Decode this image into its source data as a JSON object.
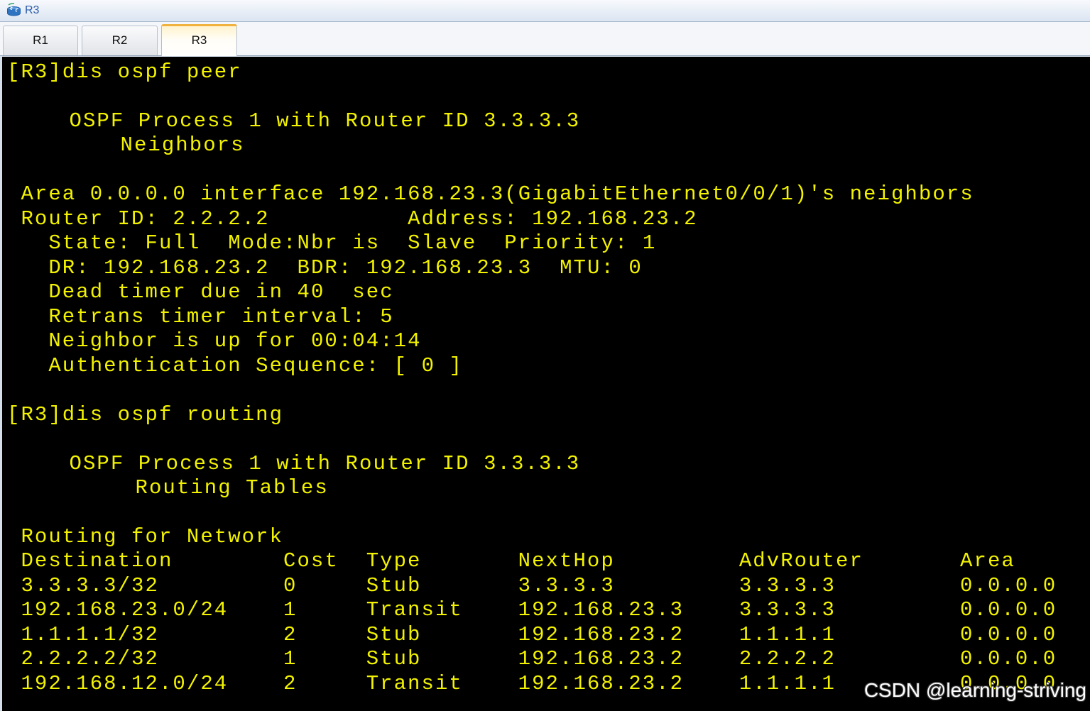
{
  "window": {
    "title": "R3",
    "icon": "router-icon"
  },
  "tabs": [
    {
      "label": "R1",
      "active": false
    },
    {
      "label": "R2",
      "active": false
    },
    {
      "label": "R3",
      "active": true
    }
  ],
  "terminal": {
    "peer": {
      "command": "[R3]dis ospf peer",
      "process_line": "OSPF Process 1 with Router ID 3.3.3.3",
      "title": "Neighbors",
      "area_line": "Area 0.0.0.0 interface 192.168.23.3(GigabitEthernet0/0/1)'s neighbors",
      "router_line": "Router ID: 2.2.2.2          Address: 192.168.23.2",
      "details": [
        "State: Full  Mode:Nbr is  Slave  Priority: 1",
        "DR: 192.168.23.2  BDR: 192.168.23.3  MTU: 0",
        "Dead timer due in 40  sec",
        "Retrans timer interval: 5",
        "Neighbor is up for 00:04:14",
        "Authentication Sequence: [ 0 ]"
      ]
    },
    "routing": {
      "command": "[R3]dis ospf routing",
      "process_line": "OSPF Process 1 with Router ID 3.3.3.3",
      "title": "Routing Tables",
      "section": "Routing for Network",
      "columns": [
        "Destination",
        "Cost",
        "Type",
        "NextHop",
        "AdvRouter",
        "Area"
      ],
      "rows": [
        [
          "3.3.3.3/32",
          "0",
          "Stub",
          "3.3.3.3",
          "3.3.3.3",
          "0.0.0.0"
        ],
        [
          "192.168.23.0/24",
          "1",
          "Transit",
          "192.168.23.3",
          "3.3.3.3",
          "0.0.0.0"
        ],
        [
          "1.1.1.1/32",
          "2",
          "Stub",
          "192.168.23.2",
          "1.1.1.1",
          "0.0.0.0"
        ],
        [
          "2.2.2.2/32",
          "1",
          "Stub",
          "192.168.23.2",
          "2.2.2.2",
          "0.0.0.0"
        ],
        [
          "192.168.12.0/24",
          "2",
          "Transit",
          "192.168.23.2",
          "1.1.1.1",
          "0.0.0.0"
        ]
      ]
    }
  },
  "watermark": "CSDN @learning-striving",
  "colors": {
    "terminal_background": "#000000",
    "terminal_text": "#f2f200",
    "title_text": "#2a5ba8",
    "active_tab_accent": "#f0b23e"
  }
}
